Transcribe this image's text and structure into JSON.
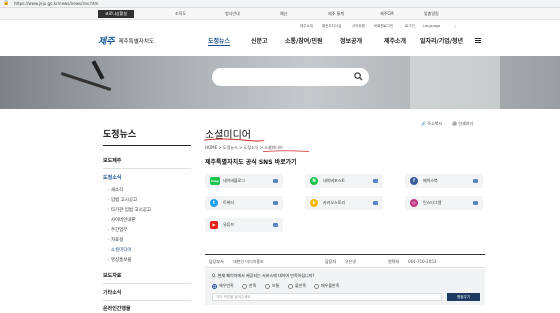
{
  "browser": {
    "url": "https://www.jeju.go.kr/news/news/sns.htm"
  },
  "topbar": {
    "corona": "코로나상황실",
    "links": [
      "조직도",
      "청사안내",
      "예산",
      "제주 통계",
      "제주CM",
      "맞춤알림"
    ]
  },
  "header": {
    "logo_mark": "제주",
    "logo_name": "제주특별자치도",
    "util_links": [
      "제주소개",
      "열린도지사실",
      "사이트맵",
      "비회원로그인",
      "로그인"
    ],
    "language": "Language",
    "nav": [
      "도정뉴스",
      "신문고",
      "소통/참여/민원",
      "정보공개",
      "제주소개",
      "일자리/기업/청년"
    ]
  },
  "sidebar": {
    "title": "도정뉴스",
    "items": [
      {
        "label": "보도자료"
      },
      {
        "label": "기타소식"
      },
      {
        "label": "온라인간행물"
      }
    ],
    "sections": [
      "보도제주",
      "도정소식"
    ],
    "subs": [
      "새소식",
      "입법 고시공고",
      "타기관 입법 고시공고",
      "사이버안내판",
      "주간업무",
      "자료실",
      "소셜미디어",
      "영상홍보물"
    ]
  },
  "content": {
    "title": "소셜미디어",
    "tools": [
      "주소복사",
      "인쇄하기"
    ],
    "breadcrumb": "HOME  >  도정뉴스  >  도정소식  >  소셜미디어",
    "sns_title": "제주특별자치도 공식 SNS 바로가기",
    "sns": [
      {
        "label": "네이버블로그",
        "color": "#19c34a",
        "glyph": "blog"
      },
      {
        "label": "네이버포스트",
        "color": "#19c34a",
        "glyph": "N"
      },
      {
        "label": "페이스북",
        "color": "#3b5998",
        "glyph": "f"
      },
      {
        "label": "트위터",
        "color": "#1da1f2",
        "glyph": "t"
      },
      {
        "label": "카카오스토리",
        "color": "#f7b500",
        "glyph": "k"
      },
      {
        "label": "인스타그램",
        "color": "#c13584",
        "glyph": "◎"
      },
      {
        "label": "유튜브",
        "color": "#e62117",
        "glyph": "▶"
      }
    ],
    "info": {
      "dept_k": "담당부서",
      "dept_v": "대변인 미디어홍보",
      "staff_k": "담당자",
      "staff_v": "유은영",
      "tel_k": "연락처",
      "tel_v": "064-710-2053"
    },
    "survey": {
      "question": "Q. 현재 페이지에서 제공되는 서비스에 대하여 만족하십니까?",
      "options": [
        "매우만족",
        "만족",
        "보통",
        "불만족",
        "매우불만족"
      ],
      "placeholder": "기타 의견을 남겨주세요",
      "submit": "평점주기"
    }
  }
}
